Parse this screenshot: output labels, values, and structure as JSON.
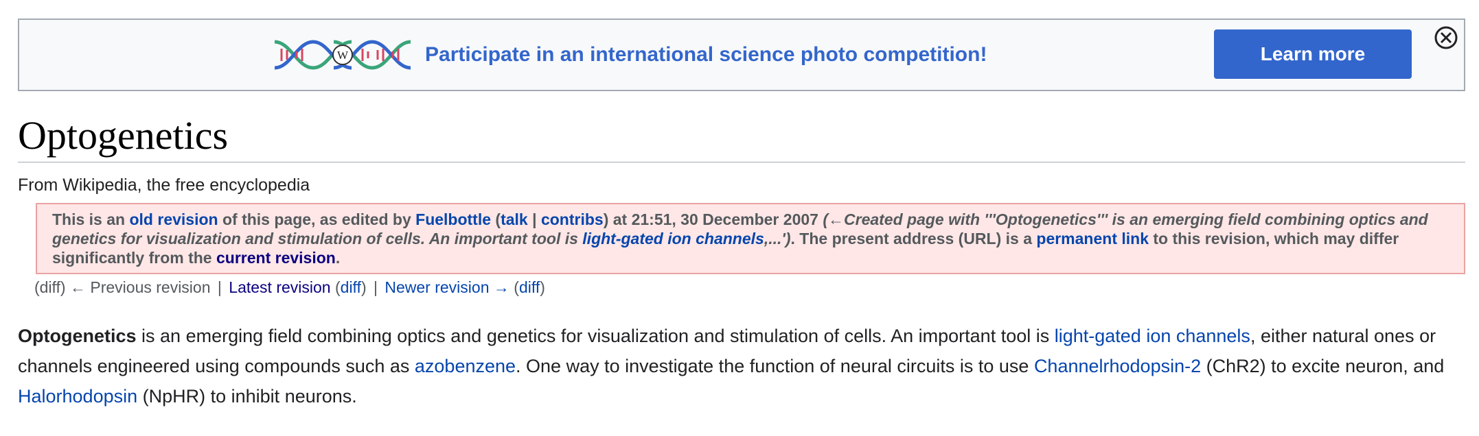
{
  "banner": {
    "text": "Participate in an international science photo competition!",
    "button_label": "Learn more",
    "logo_icon": "dna-wikipedia-logo-icon",
    "close_icon": "close-circle-icon",
    "colors": {
      "accent": "#3366cc"
    }
  },
  "article": {
    "title": "Optogenetics",
    "tagline": "From Wikipedia, the free encyclopedia"
  },
  "notice": {
    "p1": "This is an ",
    "old_revision": "old revision",
    "p2": " of this page, as edited by ",
    "user": "Fuelbottle",
    "p3": " (",
    "talk": "talk",
    "pipe": " | ",
    "contribs": "contribs",
    "p4": ") at 21:51, 30 December 2007 ",
    "summary_start": "(←Created page with '''Optogenetics''' is an emerging field combining optics and genetics for visualization and stimulation of cells. An important tool is ",
    "summary_link": "light-gated ion channels",
    "summary_end": ",...')",
    "p5": ". The present address (URL) is a ",
    "permanent_link": "permanent link",
    "p6": " to this revision, which may differ significantly from the ",
    "current_revision": "current revision",
    "p7": "."
  },
  "revnav": {
    "diff1": "(diff)",
    "previous": "← Previous revision",
    "sep1": "|",
    "latest": "Latest revision",
    "diff2_open": "(",
    "diff2": "diff",
    "diff2_close": ")",
    "sep2": "|",
    "newer": "Newer revision →",
    "diff3_open": "(",
    "diff3": "diff",
    "diff3_close": ")"
  },
  "body": {
    "t1": "Optogenetics",
    "t2": " is an emerging field combining optics and genetics for visualization and stimulation of cells. An important tool is ",
    "l1": "light-gated ion channels",
    "t3": ", either natural ones or channels engineered using compounds such as ",
    "l2": "azobenzene",
    "t4": ". One way to investigate the function of neural circuits is to use ",
    "l3": "Channelrhodopsin-2",
    "t5": " (ChR2) to excite neuron, and ",
    "l4": "Halorhodopsin",
    "t6": " (NpHR) to inhibit neurons."
  }
}
